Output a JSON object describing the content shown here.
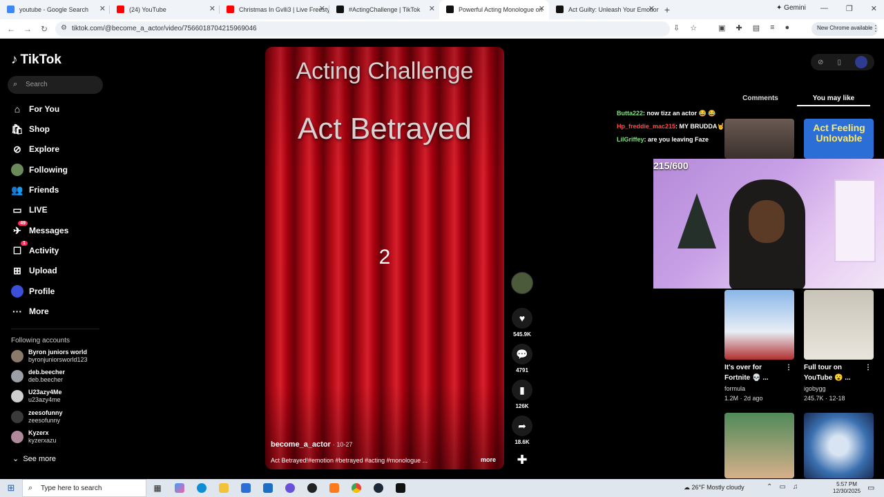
{
  "browser": {
    "tabs": [
      {
        "title": "youtube - Google Search",
        "color": "#4285f4"
      },
      {
        "title": "(24) YouTube",
        "color": "#ff0000"
      },
      {
        "title": "Christmas In Gvlli3 | Live Freestyle",
        "color": "#ff0000"
      },
      {
        "title": "#ActingChallenge | TikTok",
        "color": "#111111"
      },
      {
        "title": "Powerful Acting Monologue on",
        "color": "#111111"
      },
      {
        "title": "Act Guilty: Unleash Your Emotion",
        "color": "#111111"
      }
    ],
    "new_tab": "+",
    "gemini": "Gemini",
    "url": "tiktok.com/@become_a_actor/video/7566018704215969046",
    "new_chrome": "New Chrome available"
  },
  "sidebar": {
    "logo": "TikTok",
    "search_placeholder": "Search",
    "nav": [
      {
        "label": "For You",
        "icon": "home-icon"
      },
      {
        "label": "Shop",
        "icon": "shop-icon"
      },
      {
        "label": "Explore",
        "icon": "compass-icon"
      },
      {
        "label": "Following",
        "icon": "following-avatar-icon"
      },
      {
        "label": "Friends",
        "icon": "friends-icon"
      },
      {
        "label": "LIVE",
        "icon": "live-icon"
      },
      {
        "label": "Messages",
        "icon": "messages-icon",
        "badge": "49"
      },
      {
        "label": "Activity",
        "icon": "activity-icon",
        "badge": "1"
      },
      {
        "label": "Upload",
        "icon": "upload-icon"
      },
      {
        "label": "Profile",
        "icon": "profile-avatar-icon"
      },
      {
        "label": "More",
        "icon": "more-icon"
      }
    ],
    "following_header": "Following accounts",
    "accounts": [
      {
        "name": "Byron juniors world",
        "handle": "byronjuniorsworld123"
      },
      {
        "name": "deb.beecher",
        "handle": "deb.beecher"
      },
      {
        "name": "U23azy4Me",
        "handle": "u23azy4me"
      },
      {
        "name": "zeesofunny",
        "handle": "zeesofunny"
      },
      {
        "name": "Kyzerx",
        "handle": "kyzerxazu"
      }
    ],
    "see_more": "See more"
  },
  "video": {
    "title_top": "Acting Challenge",
    "title_main": "Act Betrayed",
    "countdown": "2",
    "author": "become_a_actor",
    "date": "· 10-27",
    "caption": "Act Betrayed!#emotion #betrayed #acting #monologue ...",
    "more": "more"
  },
  "actions": {
    "likes": "545.9K",
    "comments": "4791",
    "saves": "126K",
    "shares": "18.6K"
  },
  "right_panel": {
    "tabs": [
      "Comments",
      "You may like"
    ],
    "card_text": "Act Feeling Unlovable",
    "cards": [
      {
        "title": "It's over for Fortnite 💀 ...",
        "author": "formula",
        "stats": "1.2M · 2d ago"
      },
      {
        "title": "Full tour on YouTube 😮 ...",
        "author": "igobygg",
        "stats": "245.7K · 12-18"
      }
    ]
  },
  "stream_overlay": {
    "chat": [
      {
        "user": "Butta222",
        "message": ": now tizz an actor 😂 😂"
      },
      {
        "user": "Hp_freddie_mac215",
        "message": ": MY BRUDDA🤘"
      },
      {
        "user": "LilGriffey",
        "message": ": are you leaving Faze"
      }
    ],
    "counter": "215/600"
  },
  "taskbar": {
    "search_placeholder": "Type here to search",
    "weather": "26°F  Mostly cloudy",
    "time": "5:57 PM",
    "date": "12/30/2025"
  }
}
